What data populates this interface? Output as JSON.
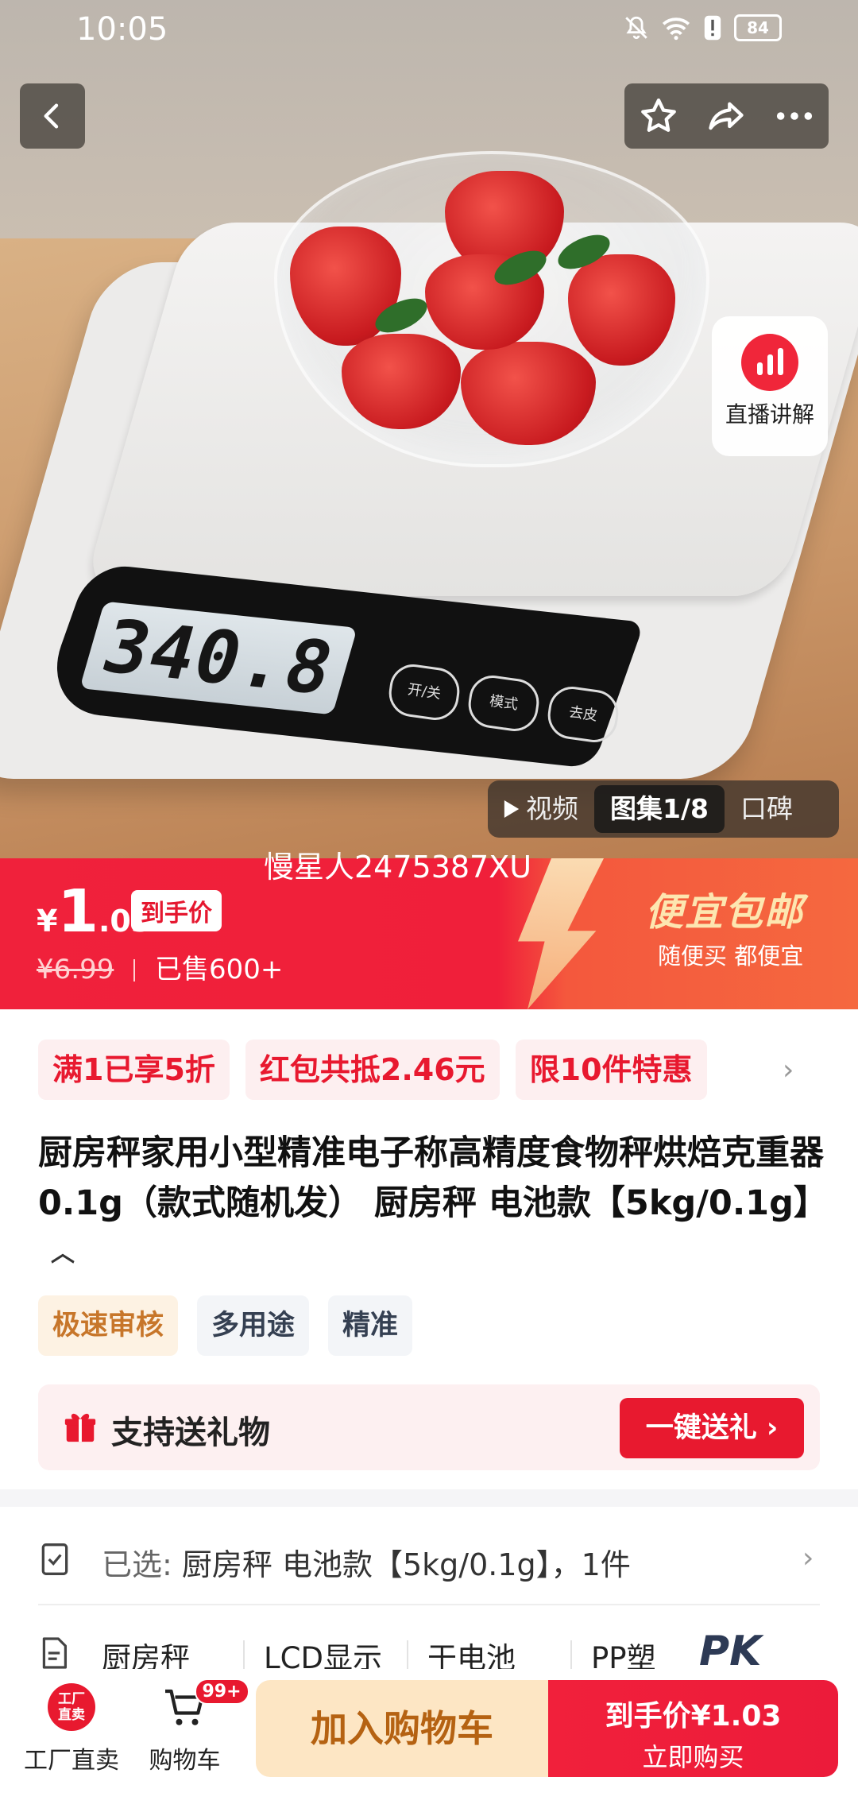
{
  "status_bar": {
    "time": "10:05",
    "battery": "84"
  },
  "hero": {
    "scale_reading": "340.8",
    "scale_buttons": [
      "开/关",
      "模式",
      "去皮"
    ],
    "live_label": "直播讲解",
    "media_tabs": [
      {
        "label": "视频"
      },
      {
        "label": "图集1/8"
      },
      {
        "label": "口碑"
      }
    ]
  },
  "watermark": "慢星人2475387XU",
  "price": {
    "currency": "¥",
    "integer": "1",
    "decimal": ".03",
    "tag": "到手价",
    "original": "¥6.99",
    "sold": "已售600+",
    "promo_title": "便宜包邮",
    "promo_sub": "随便买 都便宜"
  },
  "coupons": [
    "满1已享5折",
    "红包共抵2.46元",
    "限10件特惠"
  ],
  "coupon_more": "›",
  "product": {
    "title": "厨房秤家用小型精准电子称高精度食物秤烘焙克重器0.1g（款式随机发） 厨房秤 电池款【5kg/0.1g】",
    "tags": [
      "极速审核",
      "多用途",
      "精准"
    ]
  },
  "gift": {
    "label": "支持送礼物",
    "button": "一键送礼 ›"
  },
  "selected": {
    "prefix": "已选:",
    "value": "厨房秤 电池款【5kg/0.1g】，1件"
  },
  "specs": [
    "厨房秤",
    "LCD显示",
    "干电池",
    "PP塑"
  ],
  "pk_badge": "PK",
  "bottom_bar": {
    "factory_badge_line1": "工厂",
    "factory_badge_line2": "直卖",
    "factory_label": "工厂直卖",
    "cart_badge": "99+",
    "cart_label": "购物车",
    "add_to_cart": "加入购物车",
    "buy_line1": "到手价¥1.03",
    "buy_line2": "立即购买"
  },
  "colors": {
    "brand_red": "#e8192f",
    "cart_button_bg": "#fde6c4",
    "tag_fast_bg": "#fdf2e3"
  }
}
